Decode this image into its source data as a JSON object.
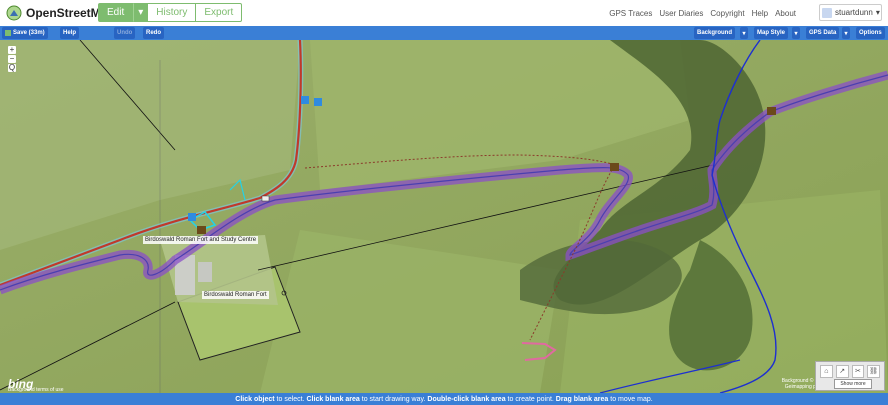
{
  "topnav": {
    "brand": "OpenStreetMap",
    "edit": "Edit",
    "history": "History",
    "export": "Export",
    "links": [
      "GPS Traces",
      "User Diaries",
      "Copyright",
      "Help",
      "About"
    ],
    "username": "stuartdunn"
  },
  "toolbar": {
    "save": "Save (33m)",
    "help": "Help",
    "undo": "Undo",
    "redo": "Redo",
    "background": "Background",
    "map_style": "Map Style",
    "gps_data": "GPS Data",
    "options": "Options"
  },
  "map": {
    "zoom_in": "+",
    "zoom_out": "−",
    "zoom_fit": "Q",
    "labels": {
      "study_centre": "Birdoswald Roman Fort and Study Centre",
      "fort": "Birdoswald Roman Fort"
    },
    "bing": "bing",
    "image_credit": "Background terms of use",
    "attribution_1": "Background © 2012",
    "attribution_2": "Geimapping plc. ©",
    "show_more": "Show more"
  },
  "footer": {
    "part1_bold": "Click object",
    "part1": " to select. ",
    "part2_bold": "Click blank area",
    "part2": " to start drawing way. ",
    "part3_bold": "Double-click blank area",
    "part3": " to create point. ",
    "part4_bold": "Drag blank area",
    "part4": " to move map."
  },
  "colors": {
    "osm_green": "#7ebc6f",
    "toolbar_blue": "#3a7fd6",
    "wall_purple": "#8b4fc8",
    "boundary_blue": "#1d2fd0"
  }
}
